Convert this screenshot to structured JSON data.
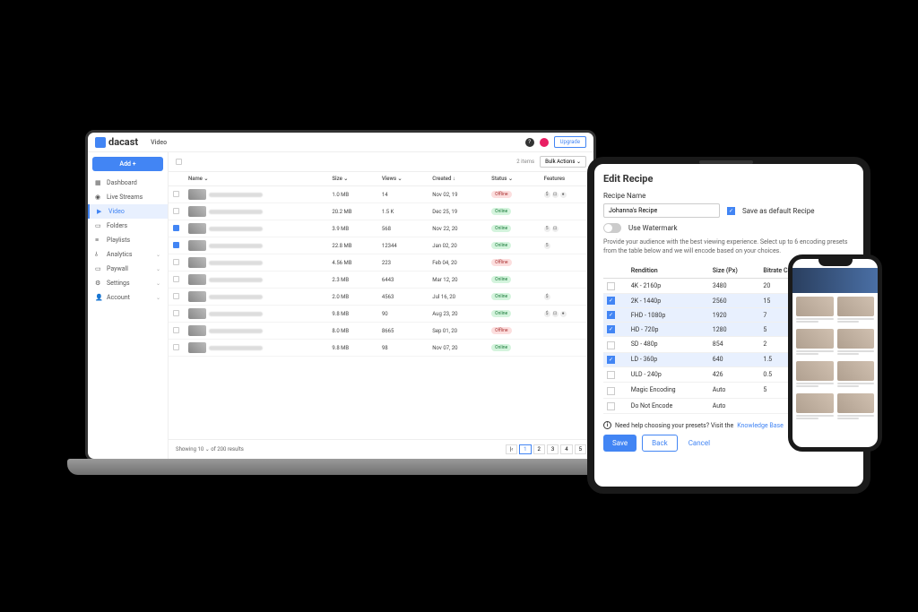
{
  "logo": "dacast",
  "header": {
    "title": "Video",
    "upgrade": "Upgrade"
  },
  "sidebar": {
    "add": "Add +",
    "items": [
      {
        "label": "Dashboard"
      },
      {
        "label": "Live Streams"
      },
      {
        "label": "Video"
      },
      {
        "label": "Folders"
      },
      {
        "label": "Playlists"
      },
      {
        "label": "Analytics"
      },
      {
        "label": "Paywall"
      },
      {
        "label": "Settings"
      },
      {
        "label": "Account"
      }
    ]
  },
  "toolbar": {
    "items": "2 items",
    "bulk": "Bulk Actions"
  },
  "columns": [
    "Name",
    "Size",
    "Views",
    "Created",
    "Status",
    "Features"
  ],
  "rows": [
    {
      "checked": false,
      "size": "1.0 MB",
      "views": "14",
      "created": "Nov 02, 19",
      "status": "Offline",
      "feat": [
        "$",
        "⊡",
        "●"
      ]
    },
    {
      "checked": false,
      "size": "20.2 MB",
      "views": "1.5 K",
      "created": "Dec 25, 19",
      "status": "Online",
      "feat": []
    },
    {
      "checked": true,
      "size": "3.9 MB",
      "views": "568",
      "created": "Nov 22, 20",
      "status": "Online",
      "feat": [
        "5",
        "⊡"
      ]
    },
    {
      "checked": true,
      "size": "22.8 MB",
      "views": "12344",
      "created": "Jan 02, 20",
      "status": "Online",
      "feat": [
        "5"
      ]
    },
    {
      "checked": false,
      "size": "4.56 MB",
      "views": "223",
      "created": "Feb 04, 20",
      "status": "Offline",
      "feat": []
    },
    {
      "checked": false,
      "size": "2.3 MB",
      "views": "6443",
      "created": "Mar 12, 20",
      "status": "Online",
      "feat": []
    },
    {
      "checked": false,
      "size": "2.0 MB",
      "views": "4563",
      "created": "Jul 16, 20",
      "status": "Online",
      "feat": [
        "$"
      ]
    },
    {
      "checked": false,
      "size": "9.8 MB",
      "views": "90",
      "created": "Aug 23, 20",
      "status": "Online",
      "feat": [
        "$",
        "⊡",
        "●"
      ]
    },
    {
      "checked": false,
      "size": "8.0 MB",
      "views": "8665",
      "created": "Sep 01, 20",
      "status": "Offline",
      "feat": []
    },
    {
      "checked": false,
      "size": "9.8 MB",
      "views": "98",
      "created": "Nov 07, 20",
      "status": "Online",
      "feat": []
    }
  ],
  "pager": {
    "showing": "Showing",
    "per": "10",
    "of": "of 200 results",
    "pages": [
      "1",
      "2",
      "3",
      "4",
      "5"
    ]
  },
  "recipe": {
    "title": "Edit Recipe",
    "label": "Recipe Name",
    "name": "Johanna's Recipe",
    "saveDefault": "Save as default Recipe",
    "watermark": "Use Watermark",
    "desc": "Provide your audience with the best viewing experience. Select up to 6 encoding presets from the table below and we will encode based on your choices.",
    "cols": [
      "Rendition",
      "Size (Px)",
      "Bitrate Cap (Mbps)"
    ],
    "rows": [
      {
        "c": false,
        "r": "4K - 2160p",
        "s": "3480",
        "b": "20"
      },
      {
        "c": true,
        "r": "2K - 1440p",
        "s": "2560",
        "b": "15"
      },
      {
        "c": true,
        "r": "FHD - 1080p",
        "s": "1920",
        "b": "7"
      },
      {
        "c": true,
        "r": "HD - 720p",
        "s": "1280",
        "b": "5"
      },
      {
        "c": false,
        "r": "SD - 480p",
        "s": "854",
        "b": "2"
      },
      {
        "c": true,
        "r": "LD - 360p",
        "s": "640",
        "b": "1.5"
      },
      {
        "c": false,
        "r": "ULD - 240p",
        "s": "426",
        "b": "0.5"
      },
      {
        "c": false,
        "r": "Magic Encoding",
        "s": "Auto",
        "b": "5"
      },
      {
        "c": false,
        "r": "Do Not Encode",
        "s": "Auto",
        "b": ""
      }
    ],
    "help": "Need help choosing your presets? Visit the",
    "kb": "Knowledge Base",
    "save": "Save",
    "back": "Back",
    "cancel": "Cancel"
  }
}
